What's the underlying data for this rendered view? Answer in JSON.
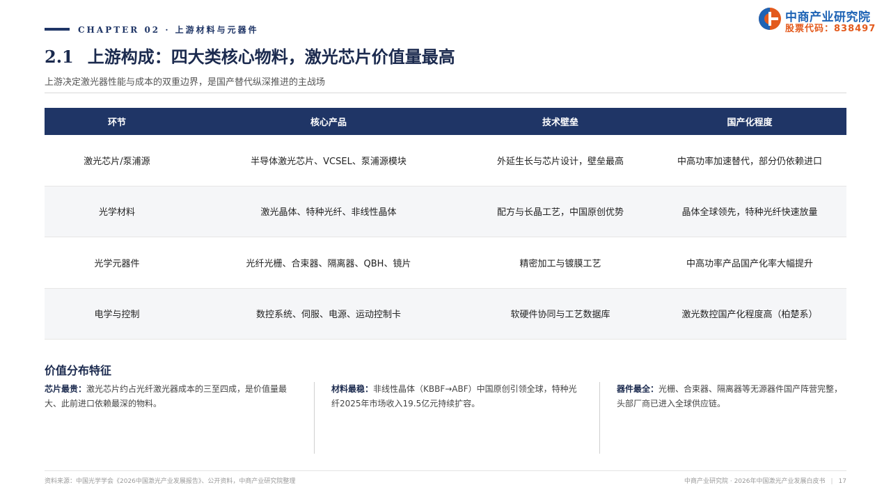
{
  "header": {
    "chapter": "CHAPTER 02 · 上游材料与元器件",
    "title_number": "2.1",
    "title_text": "上游构成：四大类核心物料，激光芯片价值量最高",
    "subtitle": "上游决定激光器性能与成本的双重边界，是国产替代纵深推进的主战场",
    "logo": {
      "name": "中商产业研究院",
      "code": "股票代码：838497",
      "colors": {
        "blue": "#1e63b5",
        "orange": "#e35a1d"
      }
    }
  },
  "table": {
    "headers": [
      "环节",
      "核心产品",
      "技术壁垒",
      "国产化程度"
    ],
    "rows": [
      [
        "激光芯片/泵浦源",
        "半导体激光芯片、VCSEL、泵浦源模块",
        "外延生长与芯片设计，壁垒最高",
        "中高功率加速替代，部分仍依赖进口"
      ],
      [
        "光学材料",
        "激光晶体、特种光纤、非线性晶体",
        "配方与长晶工艺，中国原创优势",
        "晶体全球领先，特种光纤快速放量"
      ],
      [
        "光学元器件",
        "光纤光栅、合束器、隔离器、QBH、镜片",
        "精密加工与镀膜工艺",
        "中高功率产品国产化率大幅提升"
      ],
      [
        "电学与控制",
        "数控系统、伺服、电源、运动控制卡",
        "软硬件协同与工艺数据库",
        "激光数控国产化程度高（柏楚系）"
      ]
    ]
  },
  "value": {
    "title": "价值分布特征",
    "items": [
      {
        "label": "芯片最贵：",
        "text": "激光芯片约占光纤激光器成本的三至四成，是价值量最大、此前进口依赖最深的物料。"
      },
      {
        "label": "材料最稳：",
        "text": "非线性晶体（KBBF→ABF）中国原创引领全球，特种光纤2025年市场收入19.5亿元持续扩容。"
      },
      {
        "label": "器件最全：",
        "text": "光栅、合束器、隔离器等无源器件国产阵营完整，头部厂商已进入全球供应链。"
      }
    ]
  },
  "footer": {
    "source": "资料来源：中国光学学会《2026中国激光产业发展报告》、公开资料，中商产业研究院整理",
    "publisher": "中商产业研究院 · 2026年中国激光产业发展白皮书",
    "page": "17"
  },
  "colors": {
    "navy": "#1f3566",
    "row_alt": "#f5f6f8"
  }
}
